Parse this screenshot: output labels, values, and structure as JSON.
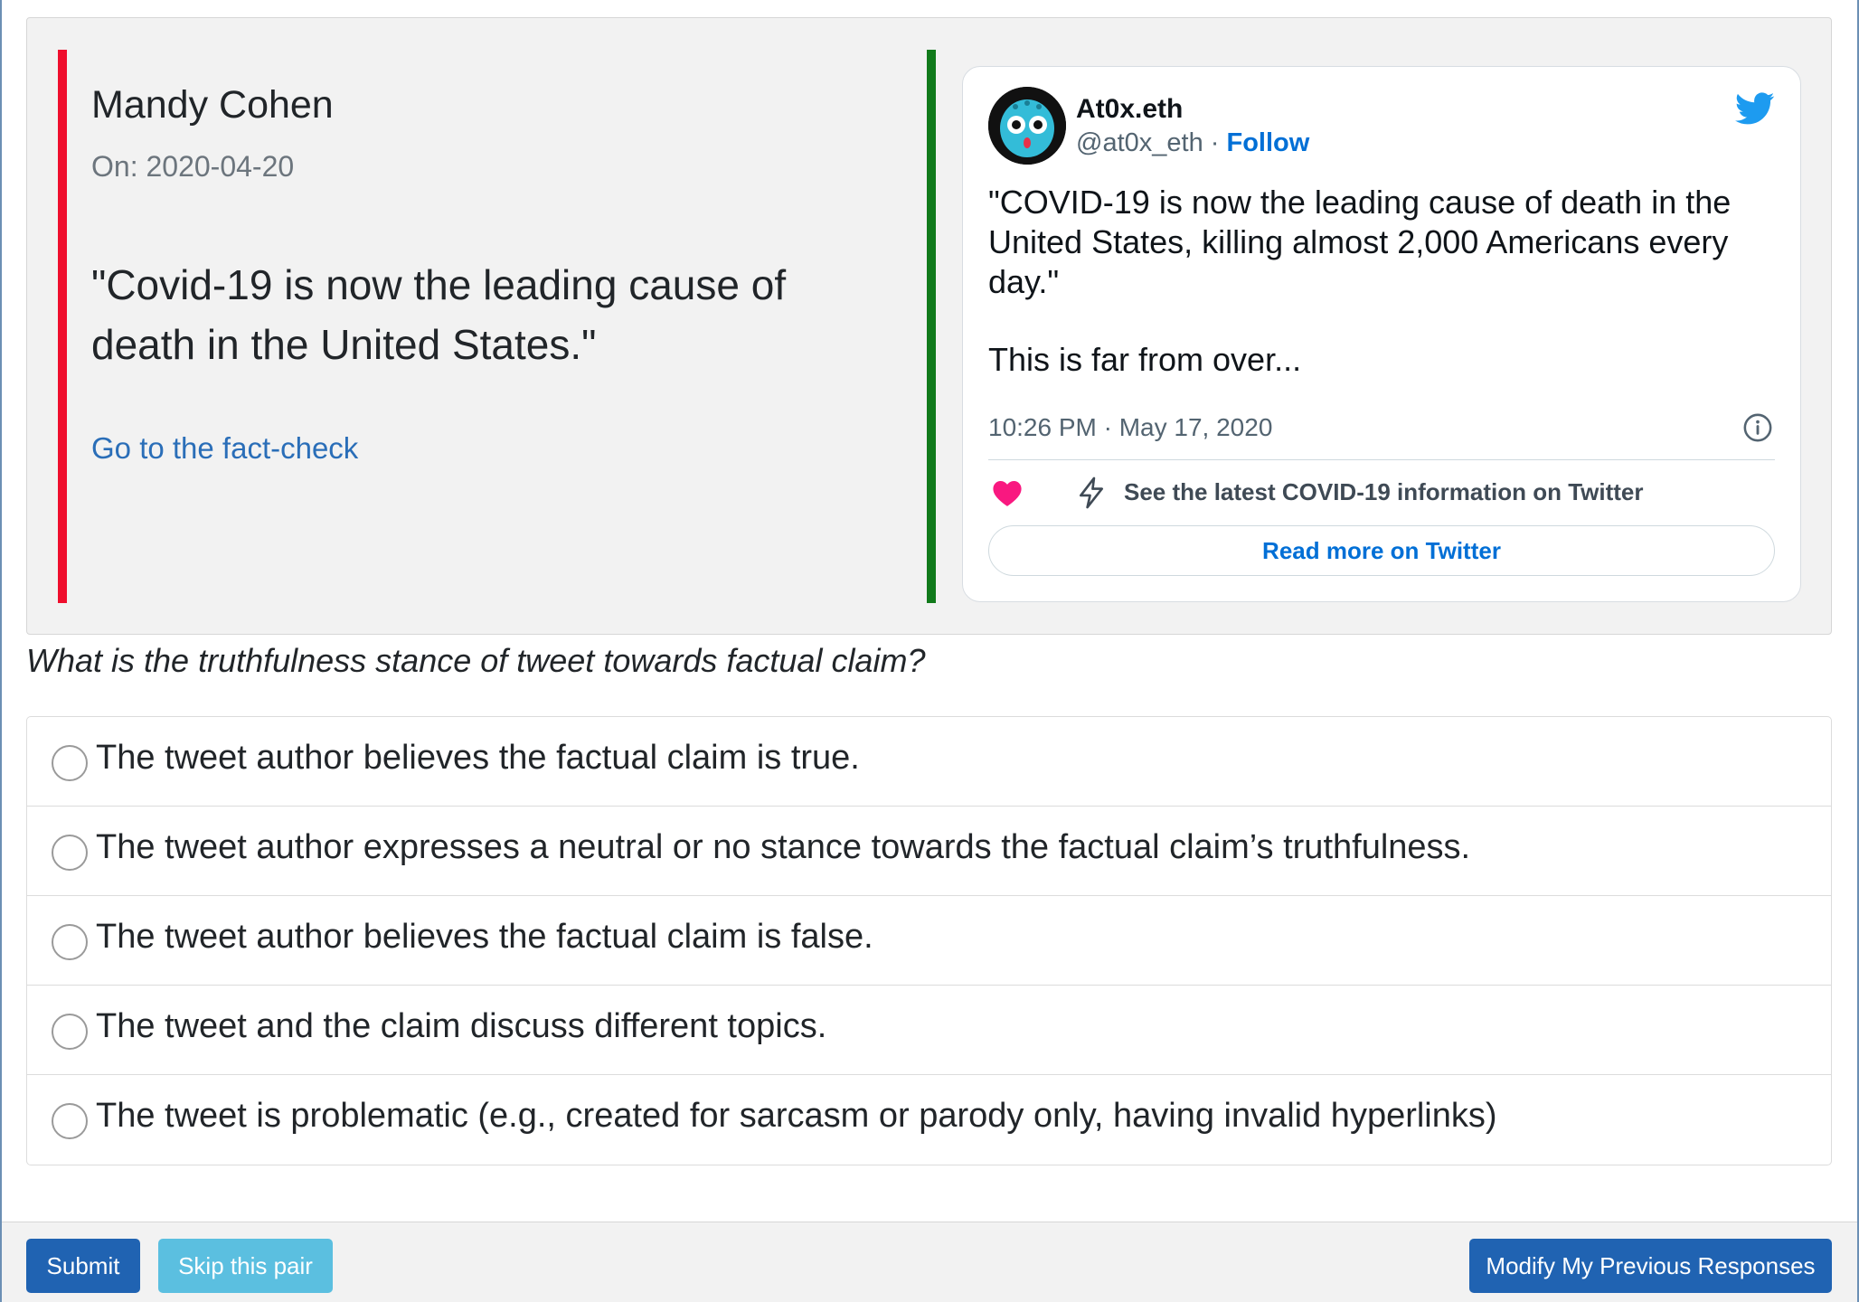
{
  "claim": {
    "speaker": "Mandy Cohen",
    "date": "On: 2020-04-20",
    "quote": "\"Covid-19 is now the leading cause of death in the United States.\"",
    "fact_check_link": "Go to the fact-check"
  },
  "tweet": {
    "author_name": "At0x.eth",
    "handle": "@at0x_eth",
    "separator": " · ",
    "follow": "Follow",
    "text_p1": "\"COVID-19 is now the leading cause of death in the United States, killing almost 2,000 Americans every day.\"",
    "text_p2": "This is far from over...",
    "timestamp": "10:26 PM · May 17, 2020",
    "covid_info": "See the latest COVID-19 information on Twitter",
    "read_more": "Read more on Twitter"
  },
  "question": "What is the truthfulness stance of tweet towards factual claim?",
  "options": [
    "The tweet author believes the factual claim is true.",
    "The tweet author expresses a neutral or no stance towards the factual claim’s truthfulness.",
    "The tweet author believes the factual claim is false.",
    "The tweet and the claim discuss different topics.",
    "The tweet is problematic (e.g., created for sarcasm or parody only, having invalid hyperlinks)"
  ],
  "buttons": {
    "submit": "Submit",
    "skip": "Skip this pair",
    "modify": "Modify My Previous Responses"
  },
  "colors": {
    "claim_bar": "#ef0e2d",
    "tweet_bar": "#117a1b",
    "link": "#2a6eb8",
    "primary_button": "#2063b2",
    "skip_button": "#5bbfe0",
    "twitter_blue": "#1d9bf0",
    "heart": "#f91880"
  },
  "icons": [
    "twitter-bird-icon",
    "info-icon",
    "heart-icon",
    "bolt-icon",
    "avatar-icon"
  ]
}
